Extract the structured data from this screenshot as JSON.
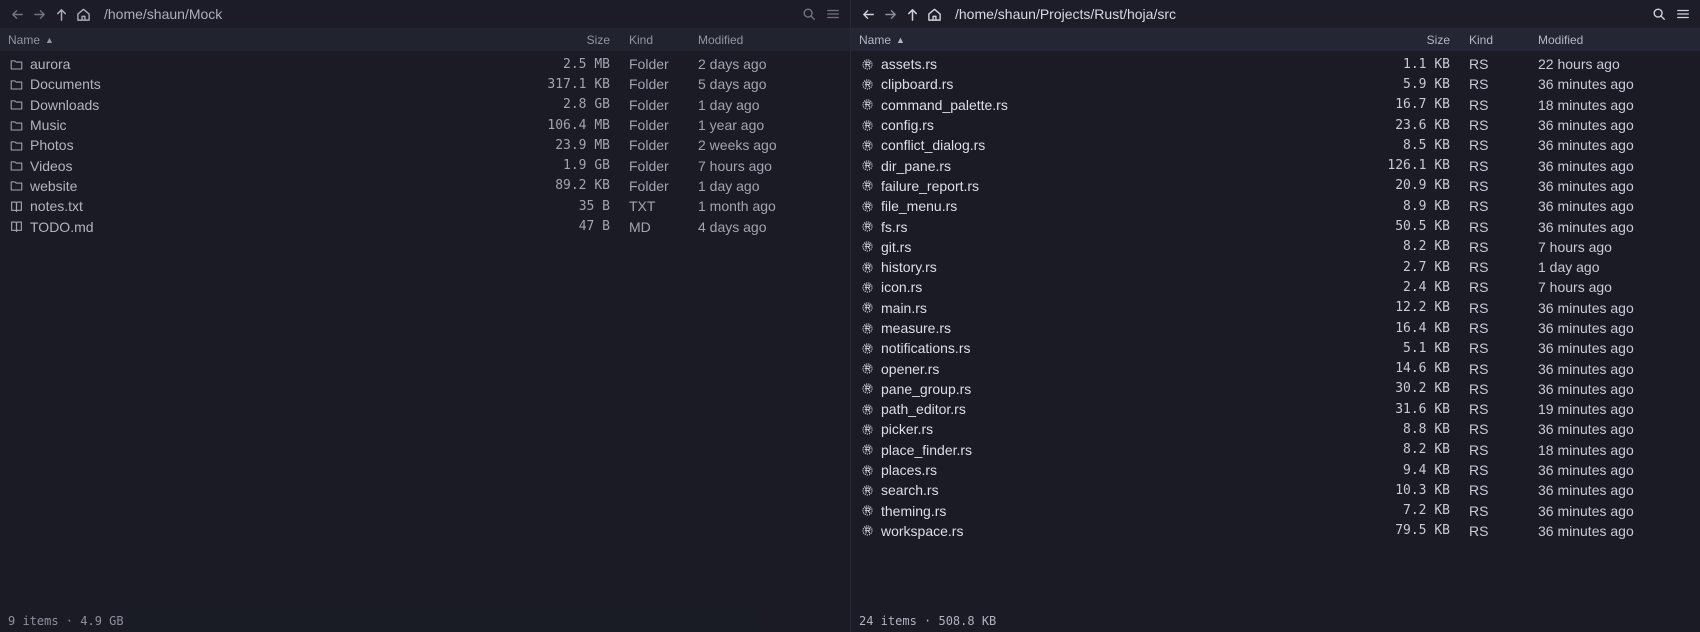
{
  "left": {
    "path": "/home/shaun/Mock",
    "header": {
      "name": "Name",
      "size": "Size",
      "kind": "Kind",
      "modified": "Modified"
    },
    "rows": [
      {
        "name": "aurora",
        "size": "2.5 MB",
        "kind": "Folder",
        "modified": "2 days ago",
        "icon": "folder-icon"
      },
      {
        "name": "Documents",
        "size": "317.1 KB",
        "kind": "Folder",
        "modified": "5 days ago",
        "icon": "folder-icon"
      },
      {
        "name": "Downloads",
        "size": "2.8 GB",
        "kind": "Folder",
        "modified": "1 day ago",
        "icon": "folder-icon"
      },
      {
        "name": "Music",
        "size": "106.4 MB",
        "kind": "Folder",
        "modified": "1 year ago",
        "icon": "folder-icon"
      },
      {
        "name": "Photos",
        "size": "23.9 MB",
        "kind": "Folder",
        "modified": "2 weeks ago",
        "icon": "folder-icon"
      },
      {
        "name": "Videos",
        "size": "1.9 GB",
        "kind": "Folder",
        "modified": "7 hours ago",
        "icon": "folder-icon"
      },
      {
        "name": "website",
        "size": "89.2 KB",
        "kind": "Folder",
        "modified": "1 day ago",
        "icon": "folder-icon"
      },
      {
        "name": "notes.txt",
        "size": "35 B",
        "kind": "TXT",
        "modified": "1 month ago",
        "icon": "book-icon"
      },
      {
        "name": "TODO.md",
        "size": "47 B",
        "kind": "MD",
        "modified": "4 days ago",
        "icon": "book-icon"
      }
    ],
    "status": "9 items · 4.9 GB"
  },
  "right": {
    "path": "/home/shaun/Projects/Rust/hoja/src",
    "header": {
      "name": "Name",
      "size": "Size",
      "kind": "Kind",
      "modified": "Modified"
    },
    "rows": [
      {
        "name": "assets.rs",
        "size": "1.1 KB",
        "kind": "RS",
        "modified": "22 hours ago",
        "icon": "rust-icon"
      },
      {
        "name": "clipboard.rs",
        "size": "5.9 KB",
        "kind": "RS",
        "modified": "36 minutes ago",
        "icon": "rust-icon"
      },
      {
        "name": "command_palette.rs",
        "size": "16.7 KB",
        "kind": "RS",
        "modified": "18 minutes ago",
        "icon": "rust-icon"
      },
      {
        "name": "config.rs",
        "size": "23.6 KB",
        "kind": "RS",
        "modified": "36 minutes ago",
        "icon": "rust-icon"
      },
      {
        "name": "conflict_dialog.rs",
        "size": "8.5 KB",
        "kind": "RS",
        "modified": "36 minutes ago",
        "icon": "rust-icon"
      },
      {
        "name": "dir_pane.rs",
        "size": "126.1 KB",
        "kind": "RS",
        "modified": "36 minutes ago",
        "icon": "rust-icon"
      },
      {
        "name": "failure_report.rs",
        "size": "20.9 KB",
        "kind": "RS",
        "modified": "36 minutes ago",
        "icon": "rust-icon"
      },
      {
        "name": "file_menu.rs",
        "size": "8.9 KB",
        "kind": "RS",
        "modified": "36 minutes ago",
        "icon": "rust-icon"
      },
      {
        "name": "fs.rs",
        "size": "50.5 KB",
        "kind": "RS",
        "modified": "36 minutes ago",
        "icon": "rust-icon"
      },
      {
        "name": "git.rs",
        "size": "8.2 KB",
        "kind": "RS",
        "modified": "7 hours ago",
        "icon": "rust-icon"
      },
      {
        "name": "history.rs",
        "size": "2.7 KB",
        "kind": "RS",
        "modified": "1 day ago",
        "icon": "rust-icon"
      },
      {
        "name": "icon.rs",
        "size": "2.4 KB",
        "kind": "RS",
        "modified": "7 hours ago",
        "icon": "rust-icon"
      },
      {
        "name": "main.rs",
        "size": "12.2 KB",
        "kind": "RS",
        "modified": "36 minutes ago",
        "icon": "rust-icon"
      },
      {
        "name": "measure.rs",
        "size": "16.4 KB",
        "kind": "RS",
        "modified": "36 minutes ago",
        "icon": "rust-icon"
      },
      {
        "name": "notifications.rs",
        "size": "5.1 KB",
        "kind": "RS",
        "modified": "36 minutes ago",
        "icon": "rust-icon"
      },
      {
        "name": "opener.rs",
        "size": "14.6 KB",
        "kind": "RS",
        "modified": "36 minutes ago",
        "icon": "rust-icon"
      },
      {
        "name": "pane_group.rs",
        "size": "30.2 KB",
        "kind": "RS",
        "modified": "36 minutes ago",
        "icon": "rust-icon"
      },
      {
        "name": "path_editor.rs",
        "size": "31.6 KB",
        "kind": "RS",
        "modified": "19 minutes ago",
        "icon": "rust-icon"
      },
      {
        "name": "picker.rs",
        "size": "8.8 KB",
        "kind": "RS",
        "modified": "36 minutes ago",
        "icon": "rust-icon"
      },
      {
        "name": "place_finder.rs",
        "size": "8.2 KB",
        "kind": "RS",
        "modified": "18 minutes ago",
        "icon": "rust-icon"
      },
      {
        "name": "places.rs",
        "size": "9.4 KB",
        "kind": "RS",
        "modified": "36 minutes ago",
        "icon": "rust-icon"
      },
      {
        "name": "search.rs",
        "size": "10.3 KB",
        "kind": "RS",
        "modified": "36 minutes ago",
        "icon": "rust-icon"
      },
      {
        "name": "theming.rs",
        "size": "7.2 KB",
        "kind": "RS",
        "modified": "36 minutes ago",
        "icon": "rust-icon"
      },
      {
        "name": "workspace.rs",
        "size": "79.5 KB",
        "kind": "RS",
        "modified": "36 minutes ago",
        "icon": "rust-icon"
      }
    ],
    "status": "24 items · 508.8 KB"
  },
  "toolbar_icons": [
    "back-arrow-icon",
    "forward-arrow-icon",
    "up-arrow-icon",
    "home-icon",
    "search-icon",
    "menu-icon"
  ],
  "colors": {
    "background": "#1a1b25",
    "header": "#242633",
    "text": "#dcdee8"
  }
}
